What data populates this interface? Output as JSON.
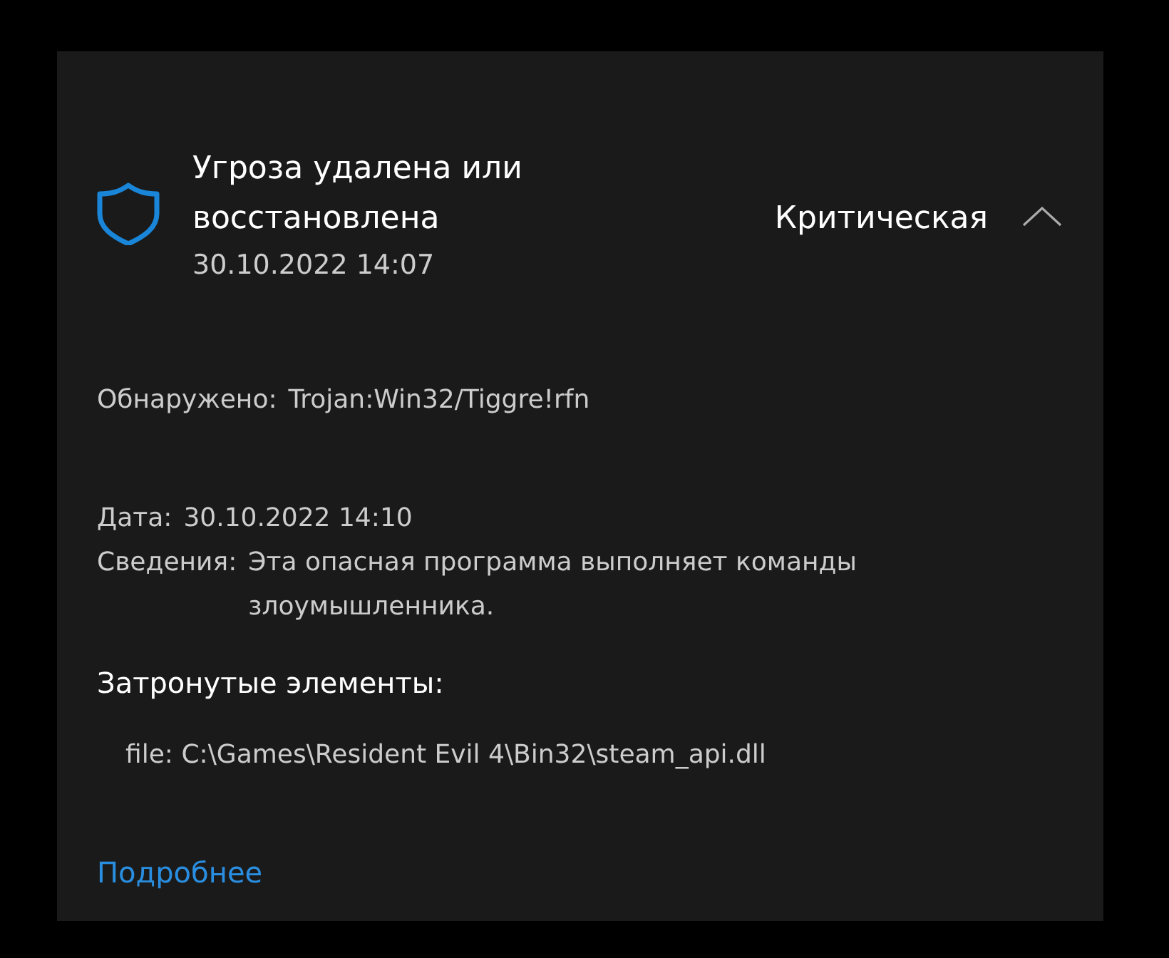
{
  "header": {
    "title": "Угроза удалена или восстановлена",
    "date": "30.10.2022 14:07",
    "severity": "Критическая",
    "expanded": true
  },
  "detected": {
    "label": "Обнаружено:",
    "value": "Trojan:Win32/Tiggre!rfn"
  },
  "details": [
    {
      "label": "Дата:",
      "value": "30.10.2022 14:10"
    },
    {
      "label": "Сведения:",
      "value": "Эта опасная программа выполняет команды злоумышленника."
    }
  ],
  "affected": {
    "heading": "Затронутые элементы:",
    "items": [
      "file: C:\\Games\\Resident Evil 4\\Bin32\\steam_api.dll"
    ]
  },
  "link": "Подробнее"
}
